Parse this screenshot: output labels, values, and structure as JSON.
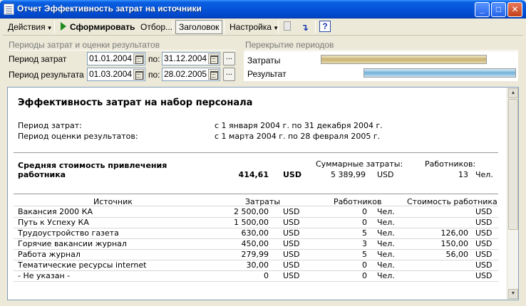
{
  "window": {
    "title": "Отчет  Эффективность затрат на источники"
  },
  "toolbar": {
    "actions": "Действия",
    "generate": "Сформировать",
    "selection": "Отбор...",
    "header": "Заголовок",
    "settings": "Настройка"
  },
  "periods": {
    "section_title": "Периоды затрат и оценки результатов",
    "cost_label": "Период затрат",
    "result_label": "Период результата",
    "to_label": "по:",
    "cost_from": "01.01.2004",
    "cost_to": "31.12.2004",
    "result_from": "01.03.2004",
    "result_to": "28.02.2005",
    "dots": "..."
  },
  "overlap": {
    "section_title": "Перекрытие периодов",
    "cost_label": "Затраты",
    "result_label": "Результат",
    "cost_bar_start": 0.0,
    "cost_bar_end": 0.85,
    "result_bar_start": 0.22,
    "result_bar_end": 1.0
  },
  "report": {
    "title": "Эффективность затрат на набор персонала",
    "cost_period_label": "Период затрат:",
    "cost_period_value": "с 1 января 2004 г. по 31 декабря 2004 г.",
    "result_period_label": "Период оценки результатов:",
    "result_period_value": "с 1 марта 2004 г. по 28 февраля 2005 г.",
    "avg_label_line1": "Средняя стоимость привлечения",
    "avg_label_line2": "работника",
    "avg_value": "414,61",
    "avg_currency": "USD",
    "total_cost_label": "Суммарные затраты:",
    "total_cost_value": "5 389,99",
    "total_cost_currency": "USD",
    "workers_label": "Работников:",
    "workers_value": "13",
    "workers_unit": "Чел.",
    "columns": {
      "source": "Источник",
      "cost": "Затраты",
      "workers": "Работников",
      "worker_cost": "Стоимость работника"
    },
    "rows": [
      {
        "source": "Вакансия 2000   КА",
        "cost": "2 500,00",
        "cur": "USD",
        "workers": "0",
        "unit": "Чел.",
        "wcost": "",
        "wcur": "USD"
      },
      {
        "source": "Путь к Успеху   КА",
        "cost": "1 500,00",
        "cur": "USD",
        "workers": "0",
        "unit": "Чел.",
        "wcost": "",
        "wcur": "USD"
      },
      {
        "source": "Трудоустройство газета",
        "cost": "630,00",
        "cur": "USD",
        "workers": "5",
        "unit": "Чел.",
        "wcost": "126,00",
        "wcur": "USD"
      },
      {
        "source": "Горячие вакансии журнал",
        "cost": "450,00",
        "cur": "USD",
        "workers": "3",
        "unit": "Чел.",
        "wcost": "150,00",
        "wcur": "USD"
      },
      {
        "source": "Работа журнал",
        "cost": "279,99",
        "cur": "USD",
        "workers": "5",
        "unit": "Чел.",
        "wcost": "56,00",
        "wcur": "USD"
      },
      {
        "source": "Тематические ресурсы internet",
        "cost": "30,00",
        "cur": "USD",
        "workers": "0",
        "unit": "Чел.",
        "wcost": "",
        "wcur": "USD"
      },
      {
        "source": "- Не указан -",
        "cost": "0",
        "cur": "USD",
        "workers": "0",
        "unit": "Чел.",
        "wcost": "",
        "wcur": "USD"
      }
    ]
  }
}
